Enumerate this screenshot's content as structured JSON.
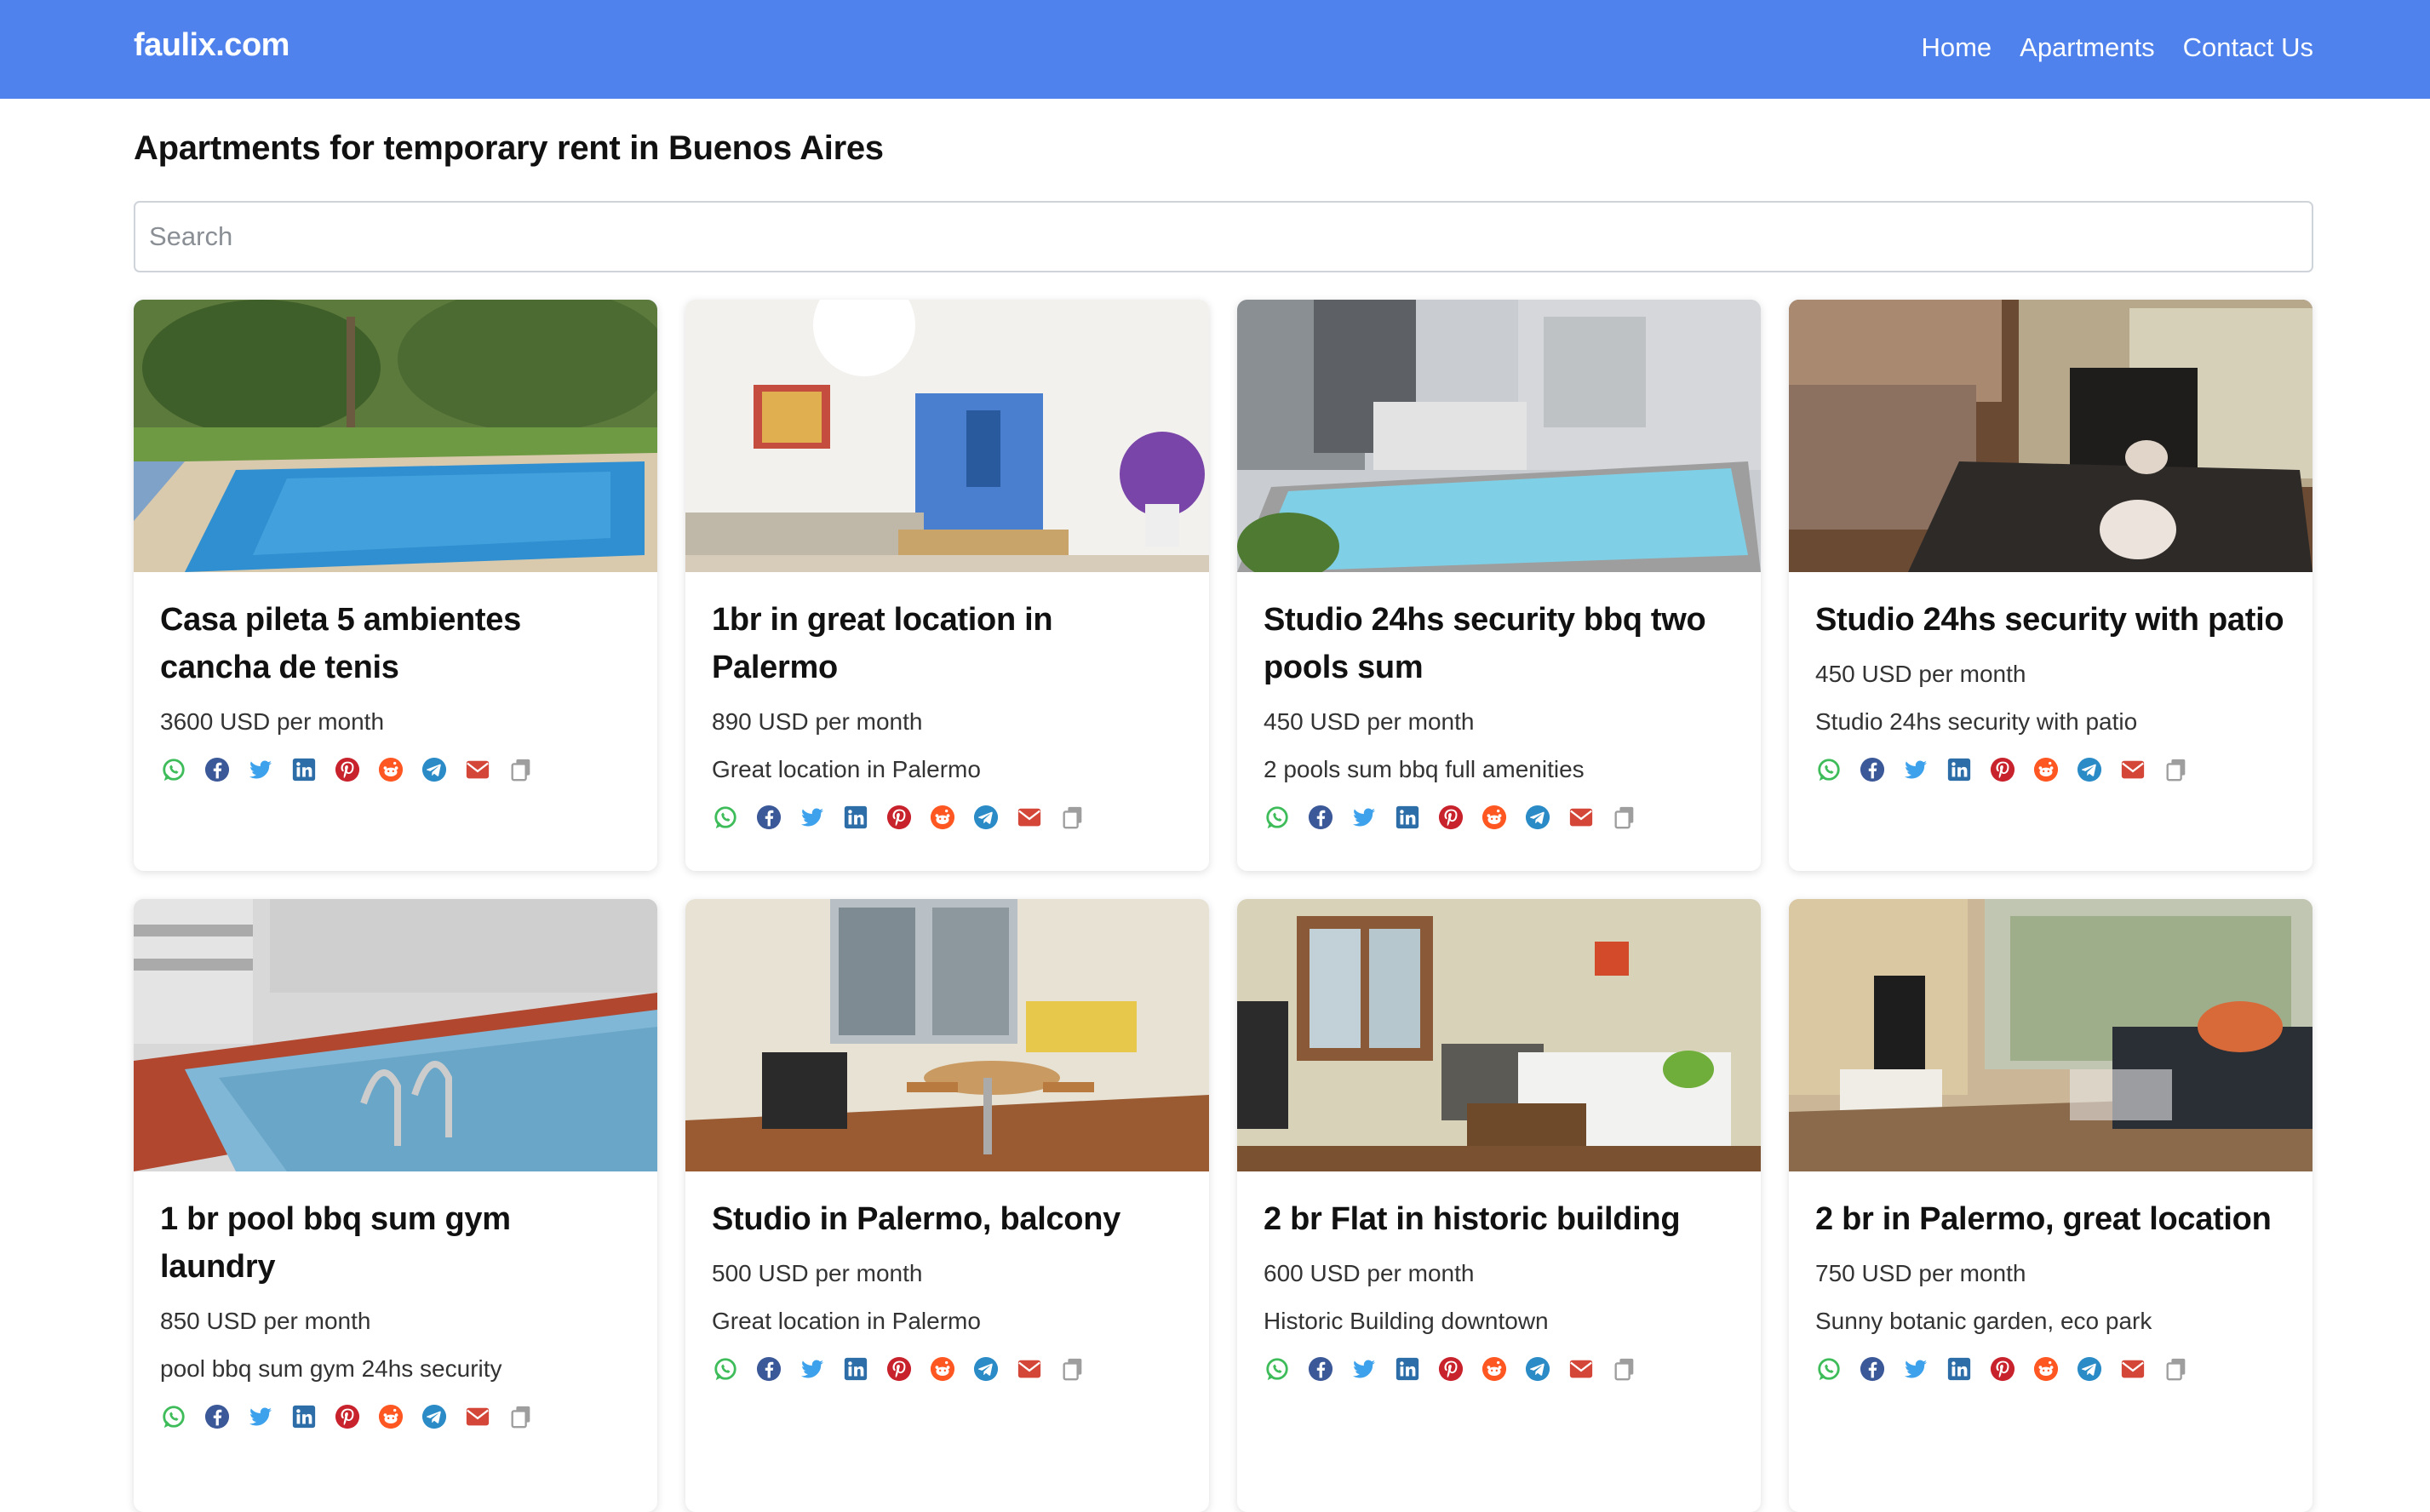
{
  "header": {
    "brand": "faulix.com",
    "nav": [
      "Home",
      "Apartments",
      "Contact Us"
    ]
  },
  "page_title": "Apartments for temporary rent in Buenos Aires",
  "search": {
    "placeholder": "Search",
    "value": ""
  },
  "colors": {
    "navbar": "#4f82ec",
    "whatsapp": "#3fbc5a",
    "facebook": "#3b5998",
    "twitter": "#3ea1ec",
    "linkedin": "#2e6ea8",
    "pinterest": "#c8232c",
    "reddit": "#ff5722",
    "telegram": "#2a8bc7",
    "email": "#d44638",
    "copy": "#9e9e9e"
  },
  "share_icons": [
    "whatsapp-icon",
    "facebook-icon",
    "twitter-icon",
    "linkedin-icon",
    "pinterest-icon",
    "reddit-icon",
    "telegram-icon",
    "email-icon",
    "copy-icon"
  ],
  "listings": [
    {
      "title": "Casa pileta 5 ambientes cancha de tenis",
      "price": "3600 USD per month",
      "description": "",
      "image": "pool-garden-photo"
    },
    {
      "title": "1br in great location in Palermo",
      "price": "890 USD per month",
      "description": "Great location in Palermo",
      "image": "bright-living-room-photo"
    },
    {
      "title": "Studio 24hs security bbq two pools sum",
      "price": "450 USD per month",
      "description": "2 pools sum bbq full amenities",
      "image": "rooftop-pool-photo"
    },
    {
      "title": "Studio 24hs security with patio",
      "price": "450 USD per month",
      "description": "Studio 24hs security with patio",
      "image": "bedroom-table-photo"
    },
    {
      "title": "1 br pool bbq sum gym laundry",
      "price": "850 USD per month",
      "description": "pool bbq sum gym 24hs security",
      "image": "pool-ladder-photo"
    },
    {
      "title": "Studio in Palermo, balcony",
      "price": "500 USD per month",
      "description": "Great location in Palermo",
      "image": "studio-dining-photo"
    },
    {
      "title": "2 br Flat in historic building",
      "price": "600 USD per month",
      "description": "Historic Building downtown",
      "image": "living-room-sofa-photo"
    },
    {
      "title": "2 br in Palermo, great location",
      "price": "750 USD per month",
      "description": "Sunny botanic garden, eco park",
      "image": "sunny-living-room-photo"
    }
  ]
}
